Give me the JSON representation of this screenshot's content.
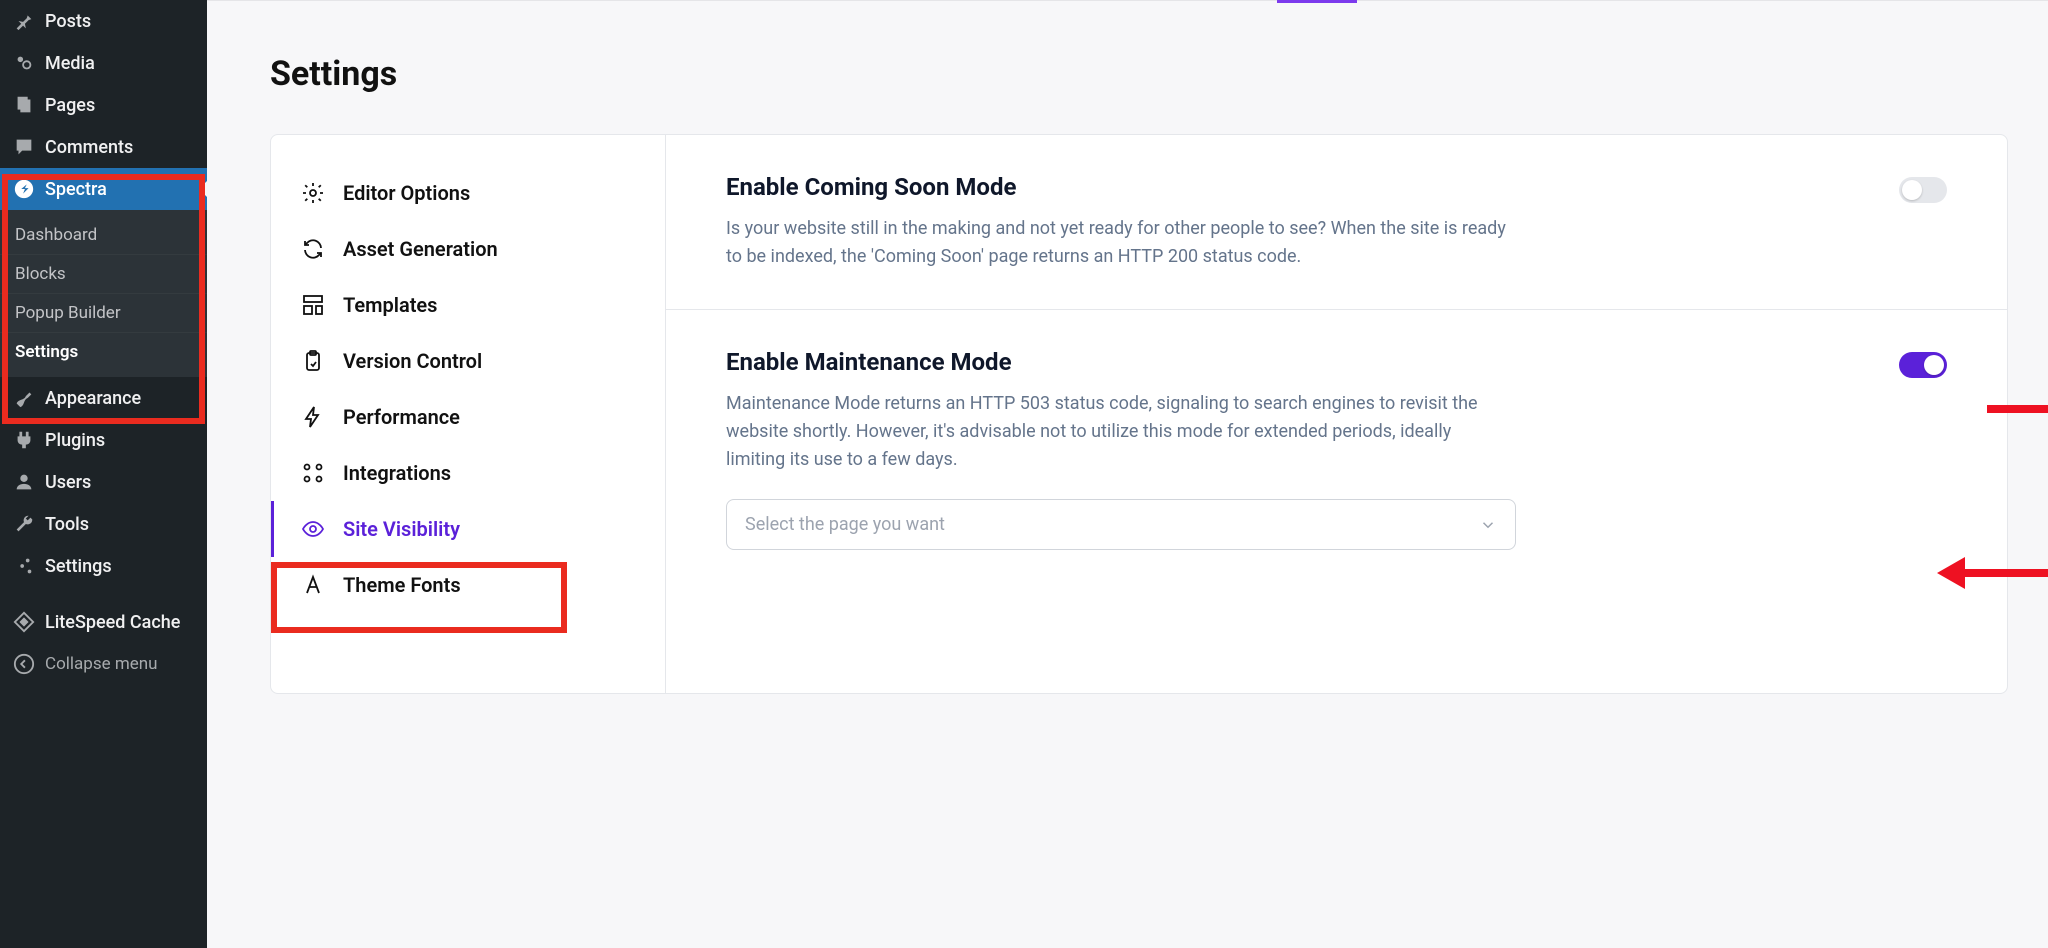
{
  "sidebar": {
    "items": [
      {
        "label": "Posts"
      },
      {
        "label": "Media"
      },
      {
        "label": "Pages"
      },
      {
        "label": "Comments"
      },
      {
        "label": "Spectra"
      },
      {
        "label": "Appearance"
      },
      {
        "label": "Plugins"
      },
      {
        "label": "Users"
      },
      {
        "label": "Tools"
      },
      {
        "label": "Settings"
      },
      {
        "label": "LiteSpeed Cache"
      }
    ],
    "spectra_submenu": [
      {
        "label": "Dashboard"
      },
      {
        "label": "Blocks"
      },
      {
        "label": "Popup Builder"
      },
      {
        "label": "Settings"
      }
    ],
    "collapse": "Collapse menu"
  },
  "page_title": "Settings",
  "settings_nav": [
    {
      "label": "Editor Options"
    },
    {
      "label": "Asset Generation"
    },
    {
      "label": "Templates"
    },
    {
      "label": "Version Control"
    },
    {
      "label": "Performance"
    },
    {
      "label": "Integrations"
    },
    {
      "label": "Site Visibility"
    },
    {
      "label": "Theme Fonts"
    }
  ],
  "coming_soon": {
    "title": "Enable Coming Soon Mode",
    "desc": "Is your website still in the making and not yet ready for other people to see? When the site is ready to be indexed, the 'Coming Soon' page returns an HTTP 200 status code.",
    "on": false
  },
  "maintenance": {
    "title": "Enable Maintenance Mode",
    "desc": "Maintenance Mode returns an HTTP 503 status code, signaling to search engines to revisit the website shortly. However, it's advisable not to utilize this mode for extended periods, ideally limiting its use to a few days.",
    "on": true,
    "select_placeholder": "Select the page you want"
  },
  "colors": {
    "accent": "#5b21d9",
    "annotation": "#ea2b1f"
  }
}
